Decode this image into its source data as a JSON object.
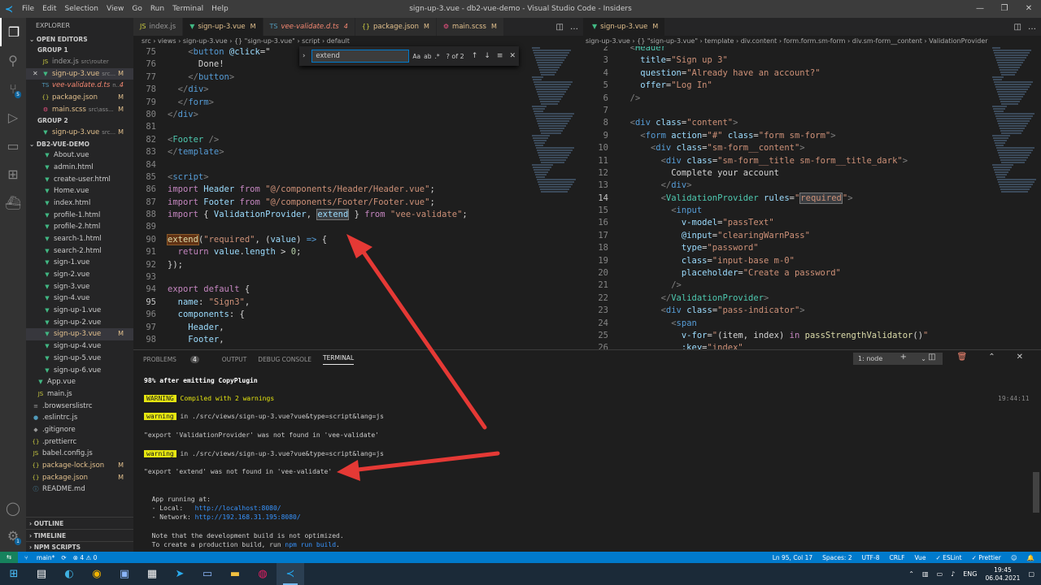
{
  "titlebar": {
    "menu": [
      "File",
      "Edit",
      "Selection",
      "View",
      "Go",
      "Run",
      "Terminal",
      "Help"
    ],
    "title": "sign-up-3.vue - db2-vue-demo - Visual Studio Code - Insiders"
  },
  "explorer": {
    "title": "EXPLORER",
    "open_editors": "OPEN EDITORS",
    "group1": "GROUP 1",
    "group2": "GROUP 2",
    "project": "DB2-VUE-DEMO",
    "g1": [
      {
        "name": "index.js",
        "dim": "src\\router",
        "st": "",
        "cls": "gray",
        "icon": "JS",
        "ic": "js"
      },
      {
        "name": "sign-up-3.vue",
        "dim": "src...",
        "st": "M",
        "cls": "mod",
        "icon": "▼",
        "ic": "vue",
        "sel": true,
        "close": true
      },
      {
        "name": "vee-validate.d.ts",
        "dim": "n...",
        "st": "4",
        "cls": "del",
        "icon": "TS",
        "ic": "ts"
      },
      {
        "name": "package.json",
        "dim": "",
        "st": "M",
        "cls": "mod",
        "icon": "{}",
        "ic": "json"
      },
      {
        "name": "main.scss",
        "dim": "src\\ass...",
        "st": "M",
        "cls": "mod",
        "icon": "⚙",
        "ic": "css"
      }
    ],
    "g2": [
      {
        "name": "sign-up-3.vue",
        "dim": "src...",
        "st": "M",
        "cls": "mod",
        "icon": "▼",
        "ic": "vue"
      }
    ],
    "files": [
      {
        "name": "About.vue",
        "icon": "▼",
        "ic": "vue"
      },
      {
        "name": "admin.html",
        "icon": "▼",
        "ic": "vue"
      },
      {
        "name": "create-user.html",
        "icon": "▼",
        "ic": "vue"
      },
      {
        "name": "Home.vue",
        "icon": "▼",
        "ic": "vue"
      },
      {
        "name": "index.html",
        "icon": "▼",
        "ic": "vue"
      },
      {
        "name": "profile-1.html",
        "icon": "▼",
        "ic": "vue"
      },
      {
        "name": "profile-2.html",
        "icon": "▼",
        "ic": "vue"
      },
      {
        "name": "search-1.html",
        "icon": "▼",
        "ic": "vue"
      },
      {
        "name": "search-2.html",
        "icon": "▼",
        "ic": "vue"
      },
      {
        "name": "sign-1.vue",
        "icon": "▼",
        "ic": "vue"
      },
      {
        "name": "sign-2.vue",
        "icon": "▼",
        "ic": "vue"
      },
      {
        "name": "sign-3.vue",
        "icon": "▼",
        "ic": "vue"
      },
      {
        "name": "sign-4.vue",
        "icon": "▼",
        "ic": "vue"
      },
      {
        "name": "sign-up-1.vue",
        "icon": "▼",
        "ic": "vue"
      },
      {
        "name": "sign-up-2.vue",
        "icon": "▼",
        "ic": "vue"
      },
      {
        "name": "sign-up-3.vue",
        "icon": "▼",
        "ic": "vue",
        "st": "M",
        "sel": true
      },
      {
        "name": "sign-up-4.vue",
        "icon": "▼",
        "ic": "vue"
      },
      {
        "name": "sign-up-5.vue",
        "icon": "▼",
        "ic": "vue"
      },
      {
        "name": "sign-up-6.vue",
        "icon": "▼",
        "ic": "vue"
      },
      {
        "name": "App.vue",
        "icon": "▼",
        "ic": "vue",
        "indent": 1
      },
      {
        "name": "main.js",
        "icon": "JS",
        "ic": "js",
        "indent": 1
      },
      {
        "name": ".browserslistrc",
        "icon": "≡",
        "ic": "gray",
        "indent": 0
      },
      {
        "name": ".eslintrc.js",
        "icon": "●",
        "ic": "ts",
        "indent": 0
      },
      {
        "name": ".gitignore",
        "icon": "◆",
        "ic": "gray",
        "indent": 0
      },
      {
        "name": ".prettierrc",
        "icon": "{}",
        "ic": "json",
        "indent": 0
      },
      {
        "name": "babel.config.js",
        "icon": "JS",
        "ic": "js",
        "indent": 0
      },
      {
        "name": "package-lock.json",
        "icon": "{}",
        "ic": "json",
        "indent": 0,
        "st": "M"
      },
      {
        "name": "package.json",
        "icon": "{}",
        "ic": "json",
        "indent": 0,
        "st": "M"
      },
      {
        "name": "README.md",
        "icon": "ⓘ",
        "ic": "ts",
        "indent": 0
      }
    ],
    "outline": "OUTLINE",
    "timeline": "TIMELINE",
    "npm": "NPM SCRIPTS"
  },
  "tabs1": [
    {
      "label": "index.js",
      "icon": "JS",
      "ic": "js",
      "mark": ""
    },
    {
      "label": "sign-up-3.vue",
      "icon": "▼",
      "ic": "vue",
      "mark": "M",
      "active": true
    },
    {
      "label": "vee-validate.d.ts",
      "icon": "TS",
      "ic": "ts",
      "mark": "4",
      "del": true
    },
    {
      "label": "package.json",
      "icon": "{}",
      "ic": "json",
      "mark": "M"
    },
    {
      "label": "main.scss",
      "icon": "⚙",
      "ic": "css",
      "mark": "M"
    }
  ],
  "tabs2": [
    {
      "label": "sign-up-3.vue",
      "icon": "▼",
      "ic": "vue",
      "mark": "M",
      "active": true
    }
  ],
  "breadcrumb1": "src › views › sign-up-3.vue › {} \"sign-up-3.vue\" › script › default",
  "breadcrumb2": "sign-up-3.vue › {} \"sign-up-3.vue\" › template › div.content › form.form.sm-form › div.sm-form__content › ValidationProvider",
  "find": {
    "value": "extend",
    "count": "? of 2"
  },
  "terminal": {
    "tabs": [
      "PROBLEMS",
      "OUTPUT",
      "DEBUG CONSOLE",
      "TERMINAL"
    ],
    "problems_count": "4",
    "selected": "1: node",
    "line1": "98% after emitting CopyPlugin",
    "warnbox": "WARNING",
    "line2": " Compiled with 2 warnings",
    "time": "19:44:11",
    "wbox": "warning",
    "line3": " in ./src/views/sign-up-3.vue?vue&type=script&lang=js",
    "line4": "\"export 'ValidationProvider' was not found in 'vee-validate'",
    "line5": " in ./src/views/sign-up-3.vue?vue&type=script&lang=js",
    "line6": "\"export 'extend' was not found in 'vee-validate'",
    "line7": "  App running at:",
    "line8a": "  - Local:   ",
    "line8b": "http://localhost:8080/",
    "line9a": "  - Network: ",
    "line9b": "http://192.168.31.195:8080/",
    "line10": "  Note that the development build is not optimized.",
    "line11a": "  To create a production build, run ",
    "line11b": "npm run build",
    "line11c": "."
  },
  "status": {
    "branch": "main*",
    "problems": "⊗ 4 ⚠ 0",
    "pos": "Ln 95, Col 17",
    "spaces": "Spaces: 2",
    "enc": "UTF-8",
    "eol": "CRLF",
    "lang": "Vue",
    "eslint": "✓ ESLint",
    "prettier": "✓ Prettier"
  },
  "taskbar": {
    "lang": "ENG",
    "time": "19:45",
    "date": "06.04.2021"
  },
  "colors": {
    "accent": "#007acc",
    "arrow": "#e53935",
    "warning": "#e5e510"
  }
}
